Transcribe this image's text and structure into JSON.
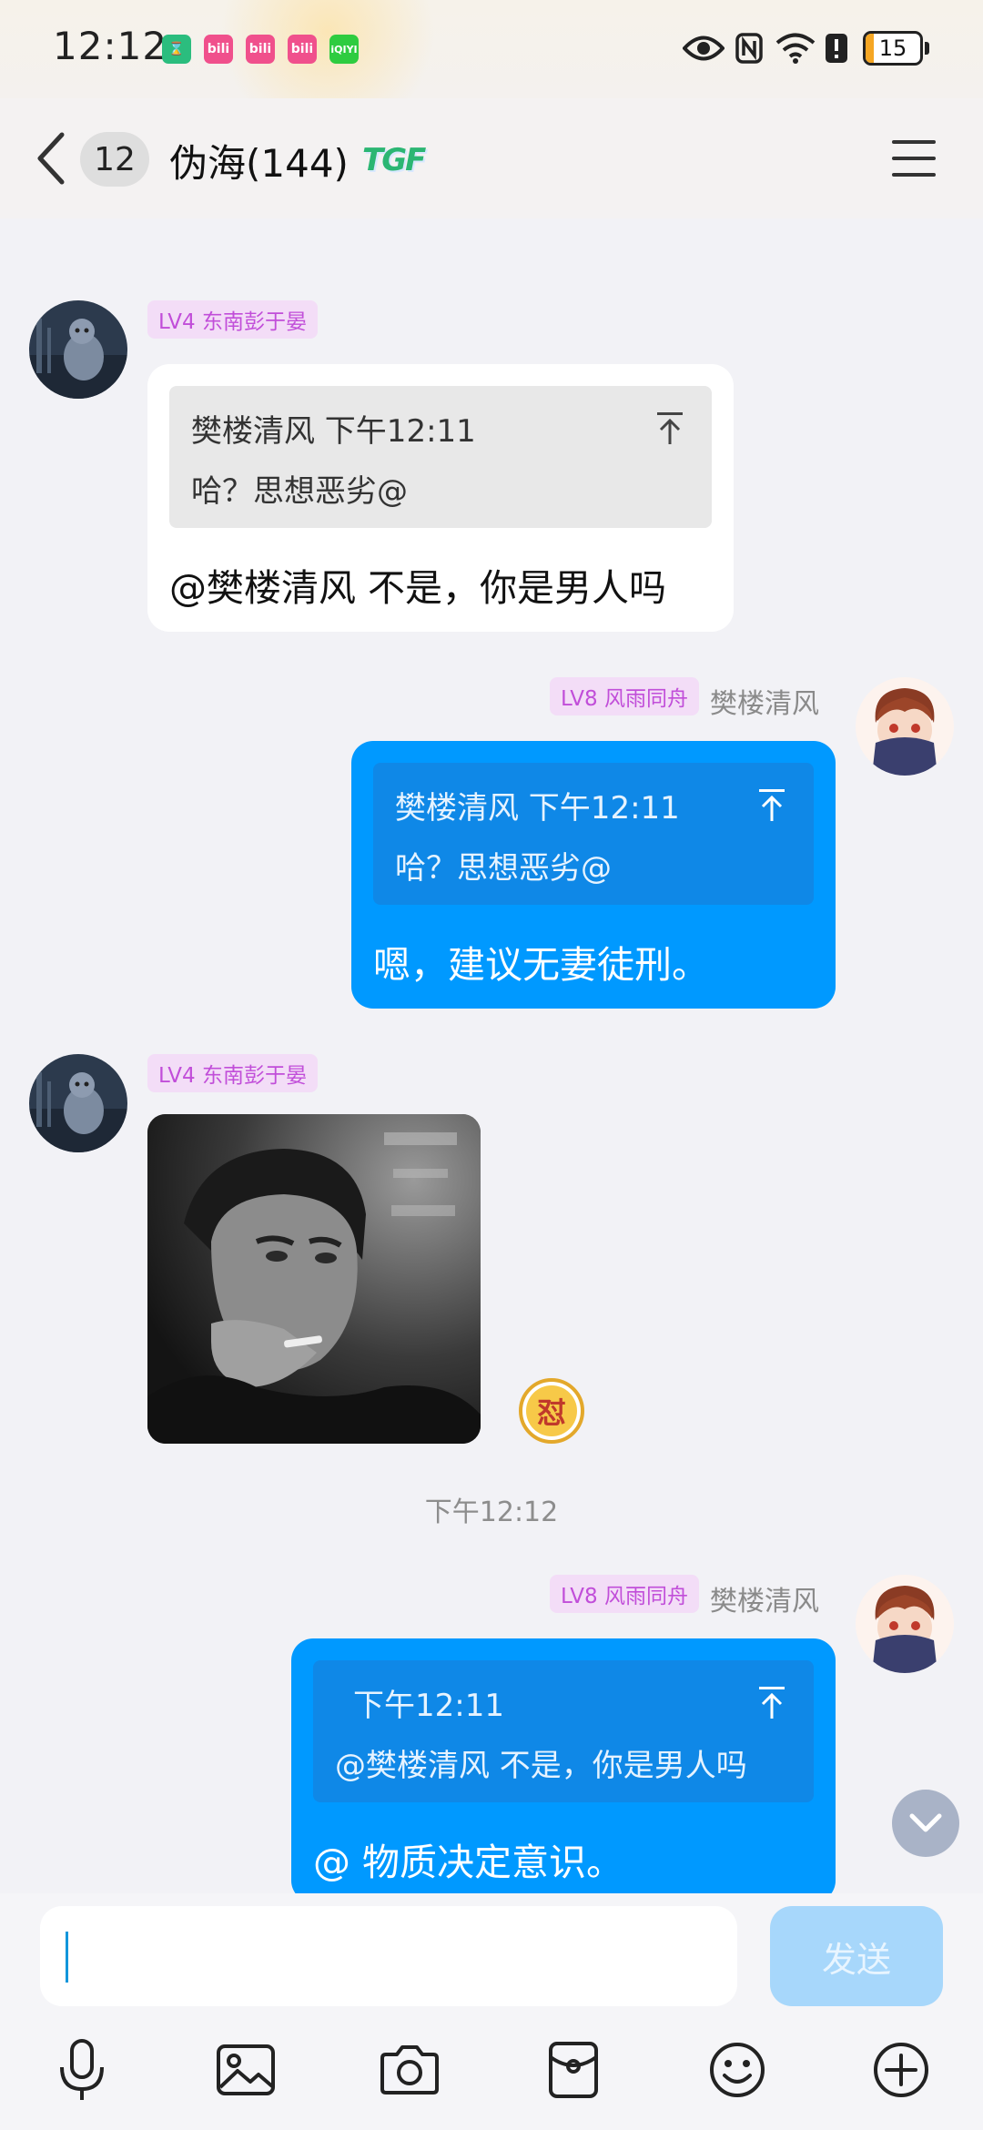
{
  "status_bar": {
    "time": "12:12",
    "notifications": [
      "hourglass-app",
      "bilibili",
      "bilibili",
      "bilibili",
      "iqiyi"
    ],
    "battery": 15,
    "battery_text": "15"
  },
  "header": {
    "unread_count": "12",
    "title": "伪海(144)",
    "badge": "TGF"
  },
  "messages": {
    "m1": {
      "level": "LV4 东南彭于晏",
      "quote_author_time": "樊楼清风  下午12:11",
      "quote_text": "哈？思想恶劣@",
      "text": "@樊楼清风 不是，你是男人吗"
    },
    "m2": {
      "level": "LV8 风雨同舟",
      "name": "樊楼清风",
      "quote_author_time": "樊楼清风  下午12:11",
      "quote_text": "哈？思想恶劣@",
      "text": "嗯，建议无妻徒刑。"
    },
    "m3": {
      "level": "LV4 东南彭于晏",
      "reaction": "怼"
    },
    "timestamp": "下午12:12",
    "m4": {
      "level": "LV8 风雨同舟",
      "name": "樊楼清风",
      "quote_time": "下午12:11",
      "quote_text": "@樊楼清风 不是，你是男人吗",
      "text": "@  物质决定意识。"
    }
  },
  "input": {
    "value": "",
    "send_label": "发送"
  },
  "colors": {
    "accent": "#0099ff",
    "level_tag_bg": "#f3ddf7",
    "level_tag_text": "#c14ed9"
  }
}
